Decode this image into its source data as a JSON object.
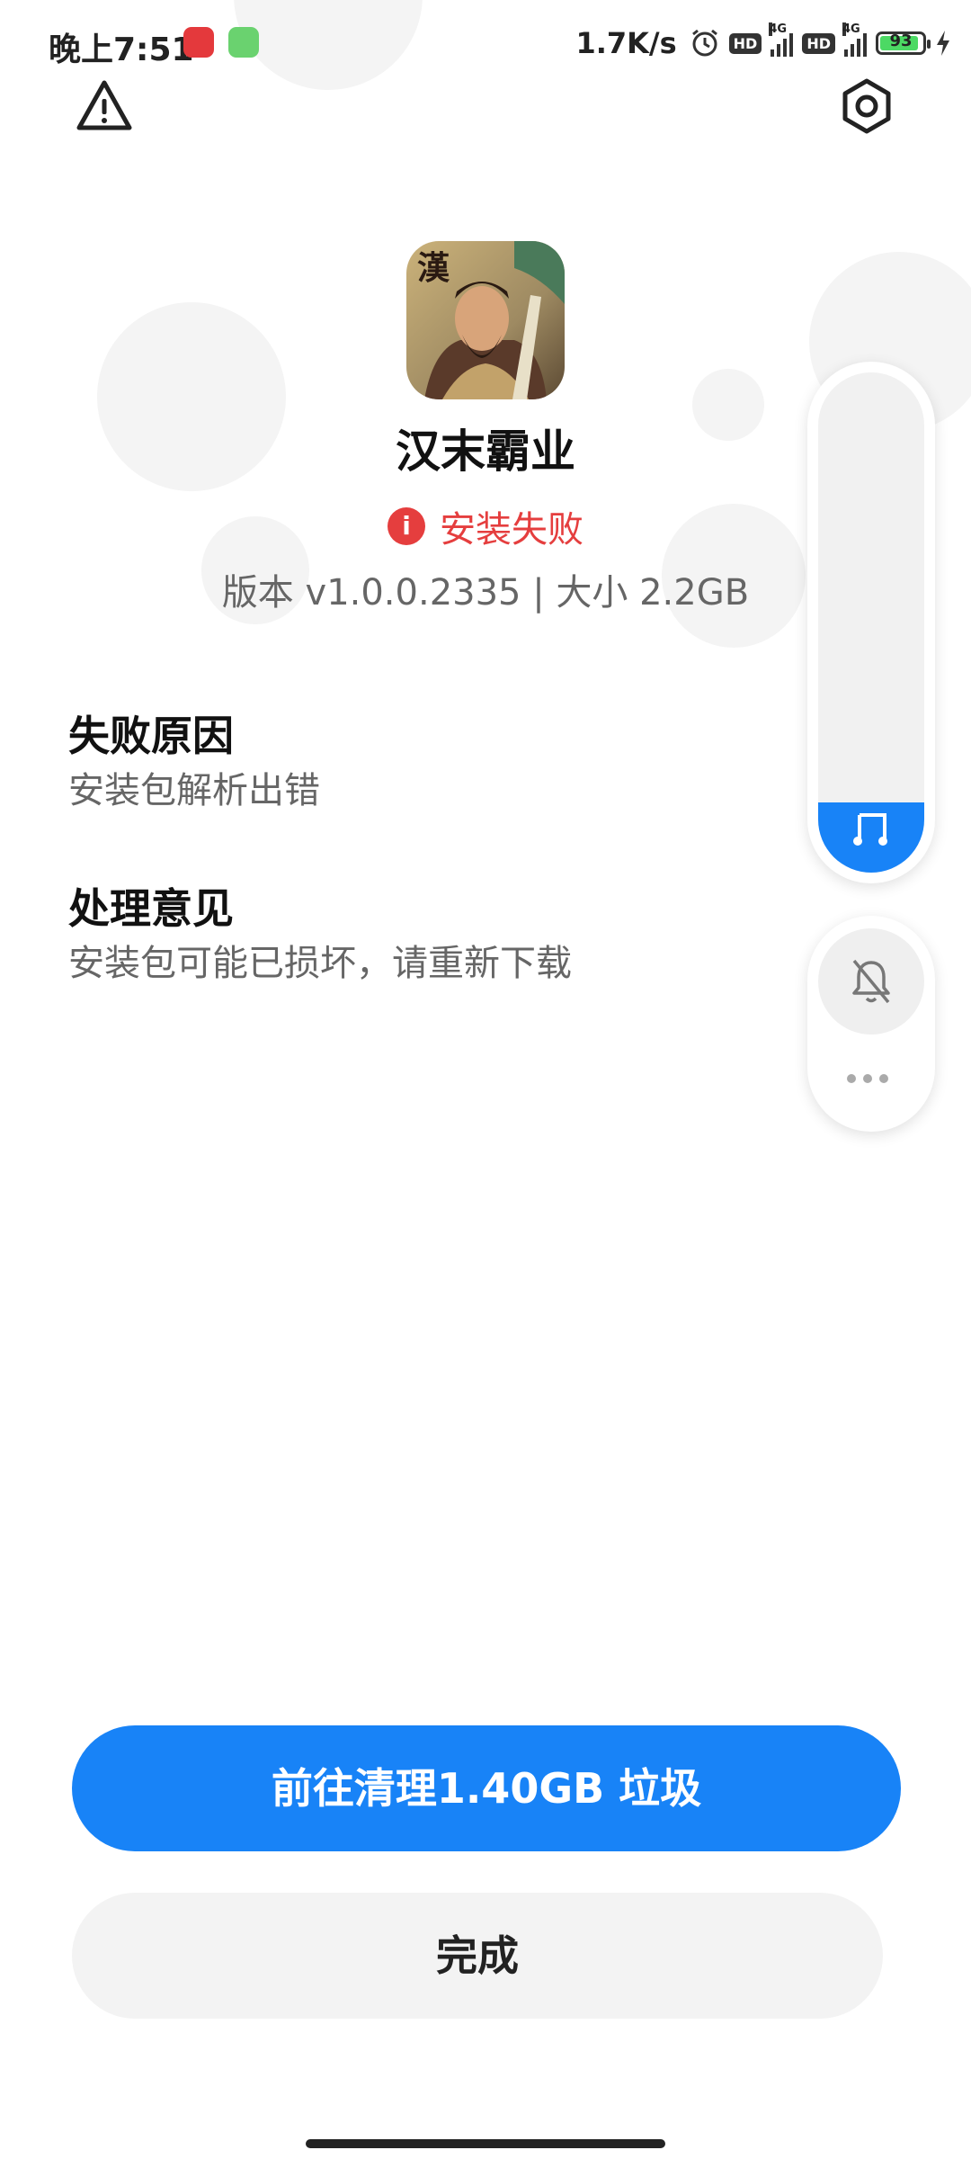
{
  "status_bar": {
    "time": "晚上7:51",
    "network_speed": "1.7K/s",
    "hd_label": "HD",
    "network_type": "4G",
    "battery_level": "93"
  },
  "app": {
    "name": "汉末霸业",
    "icon_glyph": "漢",
    "status": "安装失败",
    "meta": "版本 v1.0.0.2335 | 大小 2.2GB"
  },
  "sections": [
    {
      "title": "失败原因",
      "body": "安装包解析出错"
    },
    {
      "title": "处理意见",
      "body": "安装包可能已损坏，请重新下载"
    }
  ],
  "volume_panel": {
    "level": 0.14
  },
  "actions": {
    "primary_label": "前往清理1.40GB 垃圾",
    "secondary_label": "完成"
  },
  "colors": {
    "accent": "#1883f7",
    "error": "#e53e3e"
  },
  "icons": {
    "top_left": "warning-icon",
    "top_right": "settings-icon",
    "volume": "music-note-icon",
    "ringer": "bell-off-icon",
    "more": "more-dots-icon"
  }
}
